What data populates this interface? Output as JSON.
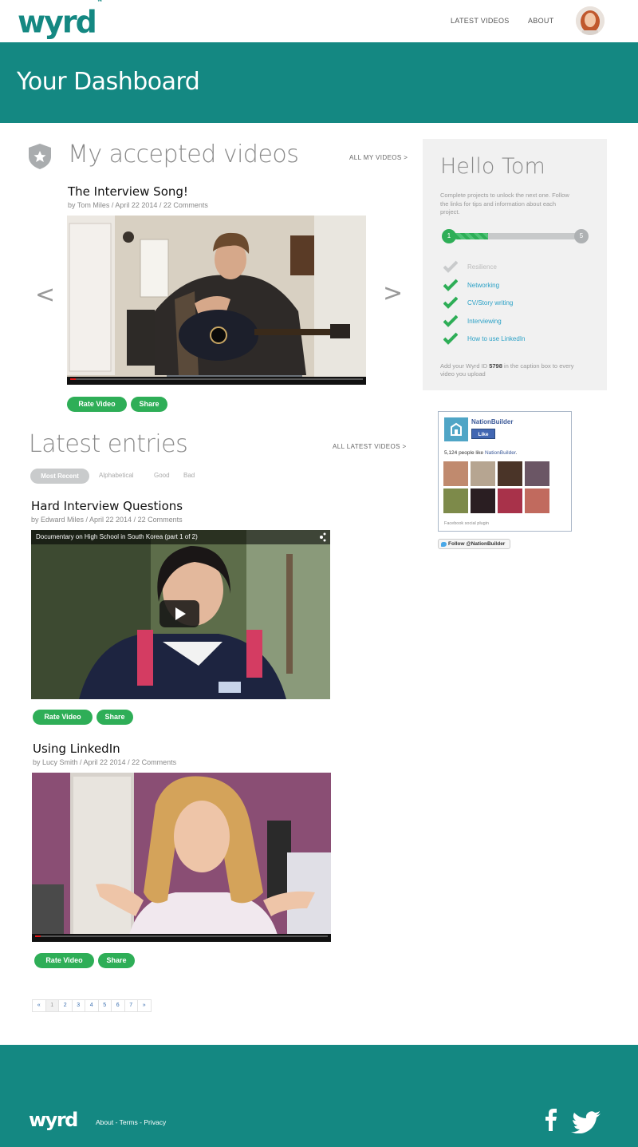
{
  "brand": {
    "logo": "wyrd",
    "trademark": "™"
  },
  "nav": {
    "latest_videos": "LATEST VIDEOS",
    "about": "ABOUT"
  },
  "hero": {
    "title": "Your Dashboard"
  },
  "accepted": {
    "title": "My accepted videos",
    "all_link": "ALL MY VIDEOS >",
    "video": {
      "title": "The Interview Song!",
      "meta": "by Tom Miles / April 22 2014 / 22 Comments"
    },
    "prev_arrow": "<",
    "next_arrow": ">"
  },
  "buttons": {
    "rate": "Rate Video",
    "share": "Share"
  },
  "latest": {
    "title": "Latest entries",
    "all_link": "ALL LATEST VIDEOS >",
    "filters": [
      "Most Recent",
      "Alphabetical",
      "Good",
      "Bad"
    ],
    "entries": [
      {
        "title": "Hard Interview Questions",
        "meta": "by Edward Miles / April 22 2014 / 22 Comments",
        "embed_title": "Documentary on High School in South Korea (part 1 of 2)"
      },
      {
        "title": "Using LinkedIn",
        "meta": "by Lucy Smith / April 22 2014 / 22 Comments"
      }
    ]
  },
  "pagination": [
    "«",
    "1",
    "2",
    "3",
    "4",
    "5",
    "6",
    "7",
    "»"
  ],
  "hello": {
    "title": "Hello Tom",
    "intro": "Complete projects to unlock the next one. Follow the links for tips and information about each project.",
    "progress": {
      "start": "1",
      "end": "5",
      "fraction": 0.3
    },
    "items": [
      {
        "label": "Resilience",
        "done": false
      },
      {
        "label": "Networking",
        "done": true
      },
      {
        "label": "CV/Story writing",
        "done": true
      },
      {
        "label": "Interviewing",
        "done": true
      },
      {
        "label": "How to use LinkedIn",
        "done": true
      }
    ],
    "footer_pre": "Add your Wyrd ID ",
    "wyrd_id": "5798",
    "footer_post": " in the caption box to every video you upload"
  },
  "facebook": {
    "page_name": "NationBuilder",
    "like": "Like",
    "count_pre": "5,124 people like ",
    "count_link": "NationBuilder",
    "count_post": ".",
    "plugin": "Facebook social plugin"
  },
  "twitter": {
    "follow": "Follow @NationBuilder"
  },
  "footer": {
    "logo": "wyrd",
    "about": "About",
    "sep": " - ",
    "terms": "Terms",
    "privacy": "Privacy"
  },
  "colors": {
    "brand": "#148882",
    "green": "#2eae57",
    "link_blue": "#2aa1c6"
  }
}
